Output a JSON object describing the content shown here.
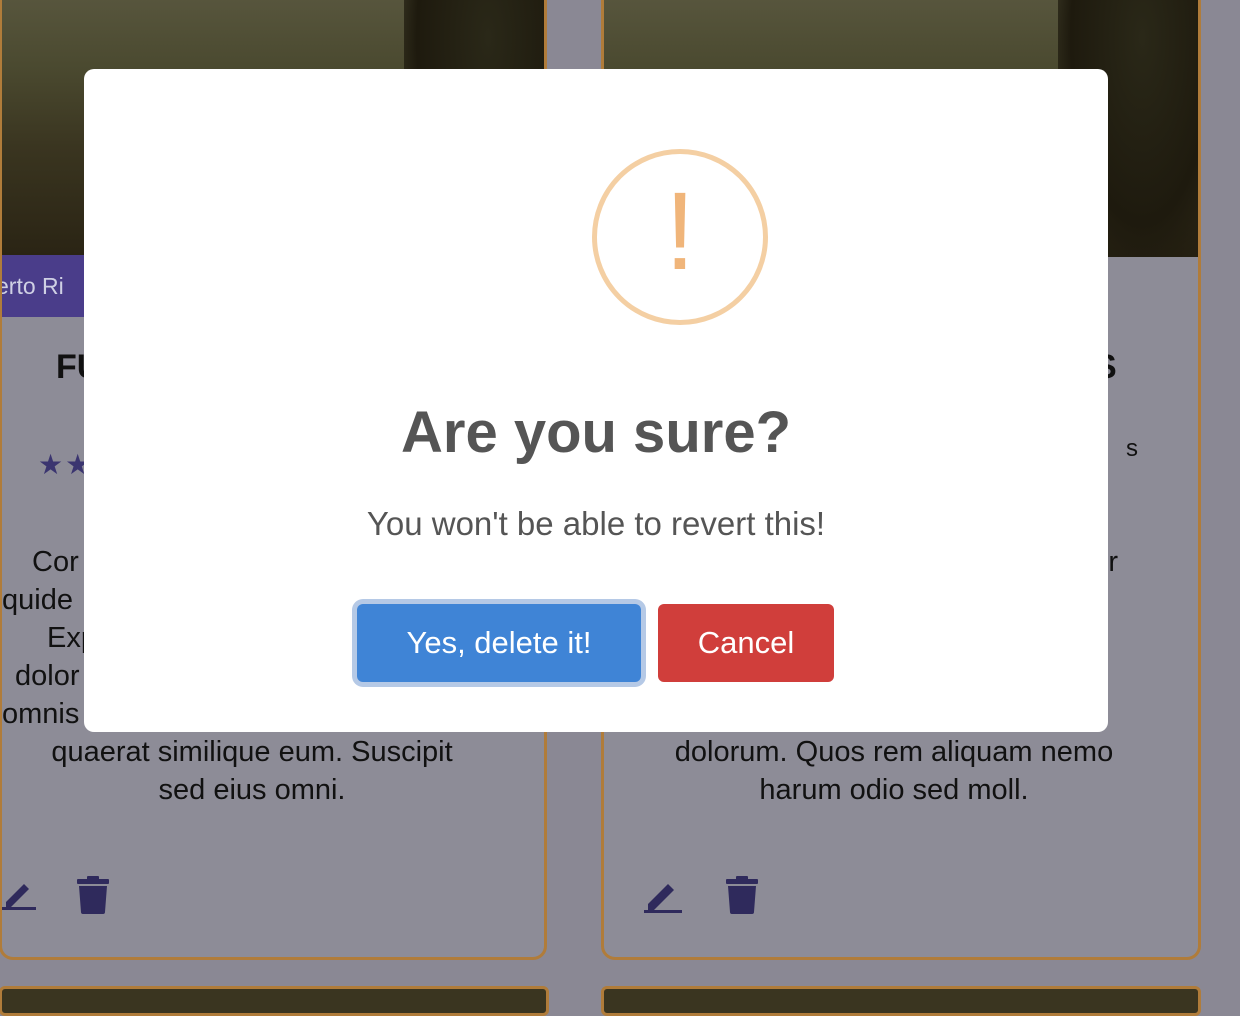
{
  "background_cards": [
    {
      "location": "erto Ri",
      "title_fragment": "FU",
      "rating_stars": "★★",
      "description": "Cor\nquide\nExp\ndolor\nomnis\nquaerat similique eum. Suscipit\nsed eius omni."
    },
    {
      "title_fragment": "S",
      "meta_fragment": "s",
      "description": "tur\n\nut\nn\ns\ndolorum. Quos rem aliquam nemo\nharum odio sed moll."
    }
  ],
  "dialog": {
    "icon": "warning-icon",
    "icon_glyph": "!",
    "title": "Are you sure?",
    "text": "You won't be able to revert this!",
    "confirm_label": "Yes, delete it!",
    "cancel_label": "Cancel"
  },
  "colors": {
    "confirm": "#3f84d6",
    "cancel": "#d03e3b",
    "warning": "#f0b57a",
    "card_border": "#b07c3a",
    "accent": "#4a3d8a"
  }
}
